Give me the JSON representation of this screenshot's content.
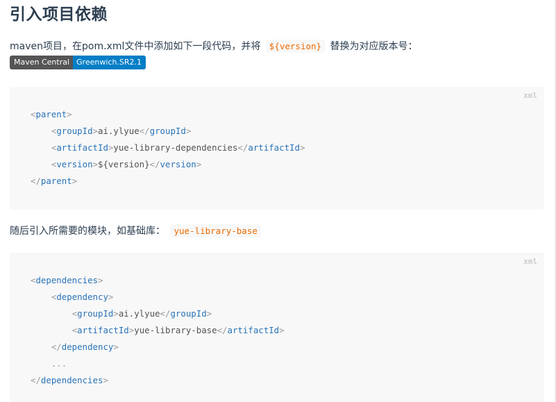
{
  "heading": "引入项目依赖",
  "intro": {
    "before": "maven项目，在pom.xml文件中添加如下一段代码，并将",
    "code": "${version}",
    "after": "替换为对应版本号："
  },
  "badge": {
    "left": "Maven Central",
    "right": "Greenwich.SR2.1"
  },
  "block1": {
    "lang": "xml",
    "lines": [
      {
        "indent": "",
        "name": "parent",
        "text": "",
        "close": false,
        "open_only": true
      },
      {
        "indent": "    ",
        "name": "groupId",
        "text": "ai.ylyue"
      },
      {
        "indent": "    ",
        "name": "artifactId",
        "text": "yue-library-dependencies"
      },
      {
        "indent": "    ",
        "name": "version",
        "text": "${version}"
      },
      {
        "indent": "",
        "name": "parent",
        "close_only": true
      }
    ]
  },
  "second": {
    "before": "随后引入所需要的模块，如基础库：",
    "code": "yue-library-base"
  },
  "block2": {
    "lang": "xml",
    "lines": [
      {
        "indent": "",
        "name": "dependencies",
        "open_only": true
      },
      {
        "indent": "    ",
        "name": "dependency",
        "open_only": true
      },
      {
        "indent": "        ",
        "name": "groupId",
        "text": "ai.ylyue"
      },
      {
        "indent": "        ",
        "name": "artifactId",
        "text": "yue-library-base"
      },
      {
        "indent": "    ",
        "name": "dependency",
        "close_only": true
      },
      {
        "indent": "    ",
        "plain": "..."
      },
      {
        "indent": "",
        "name": "dependencies",
        "close_only": true
      }
    ]
  }
}
